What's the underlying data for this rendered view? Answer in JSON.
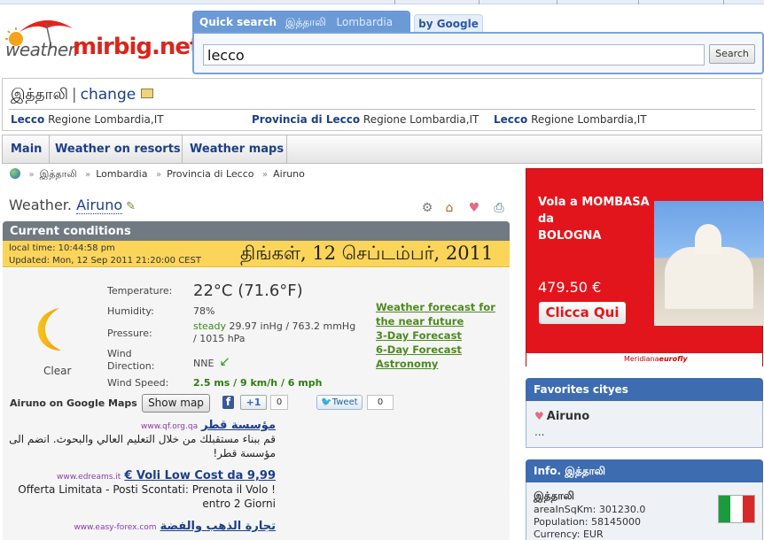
{
  "logo": {
    "part1": "weather.",
    "part2": "mirbig.net"
  },
  "quick_search": {
    "tab_label": "Quick search",
    "country": "இத்தாலி",
    "region": "Lombardia",
    "google_tab": "by Google",
    "value": "lecco",
    "button": "Search"
  },
  "location": {
    "country": "இத்தாலி",
    "separator": "|",
    "change_link": "change",
    "results": [
      {
        "name": "Lecco",
        "detail": "Regione Lombardia,IT"
      },
      {
        "name": "Provincia di Lecco",
        "detail": "Regione Lombardia,IT"
      },
      {
        "name": "Lecco",
        "detail": "Regione Lombardia,IT"
      }
    ]
  },
  "nav": {
    "items": [
      "Main",
      "Weather on resorts",
      "Weather maps"
    ]
  },
  "breadcrumb": [
    "இத்தாலி",
    "Lombardia",
    "Provincia di Lecco",
    "Airuno"
  ],
  "page": {
    "prefix": "Weather.",
    "city": "Airuno"
  },
  "current": {
    "header": "Current conditions",
    "local_time": "local time: 10:44:58 pm",
    "updated": "Updated: Mon, 12 Sep 2011 21:20:00 CEST",
    "date_big": "திங்கள், 12 செப்டம்பர், 2011",
    "condition": "Clear",
    "labels": {
      "temperature": "Temperature:",
      "humidity": "Humidity:",
      "pressure": "Pressure:",
      "wind_direction_1": "Wind",
      "wind_direction_2": "Direction:",
      "wind_speed": "Wind Speed:"
    },
    "values": {
      "temperature": "22°C (71.6°F)",
      "humidity": "78%",
      "pressure_trend": "steady",
      "pressure_1": "29.97 inHg / 763.2 mmHg",
      "pressure_2": "/ 1015 hPa",
      "wind_direction": "NNE",
      "wind_speed": "2.5 ms / 9 km/h / 6 mph"
    },
    "links": [
      "Weather forecast for",
      "the near future",
      "3-Day Forecast",
      "6-Day Forecast",
      "Astronomy"
    ]
  },
  "maps": {
    "label": "Airuno on Google Maps",
    "show_map": "Show map",
    "fb": "f",
    "gplus": "+1",
    "gplus_count": "0",
    "tweet": "Tweet",
    "tweet_count": "0"
  },
  "ads": [
    {
      "url": "www.qf.org.qa",
      "title": "مؤسسة قطر",
      "body": "قم ببناء مستقبلك من خلال التعليم العالي والبحوث. انضم الى مؤسسة قطر!"
    },
    {
      "url": "www.edreams.it",
      "title": "€ Voli Low Cost da 9,99",
      "body": "Offerta Limitata - Posti Scontati: Prenota il Volo ! entro 2 Giorni"
    },
    {
      "url": "www.easy-forex.com",
      "title": "تجارة الذهب والفضة",
      "body": ""
    }
  ],
  "banner": {
    "line1": "Vola a MOMBASA",
    "line2": "da",
    "line3": "BOLOGNA",
    "price": "479.50 €",
    "cta": "Clicca Qui",
    "footer_1": "Meridiana",
    "footer_2": "eurofly"
  },
  "favorites": {
    "header": "Favorites cityes",
    "city": "Airuno",
    "more": "..."
  },
  "info": {
    "header": "Info. இத்தாலி",
    "country": "இத்தாலி",
    "area": "areaInSqKm: 301230.0",
    "population": "Population: 58145000",
    "currency": "Currency: EUR"
  },
  "colors": {
    "accent": "#3d6cb0",
    "date_bar": "#fbd55a",
    "banner": "#e3151c",
    "link_green": "#4f8a20"
  }
}
